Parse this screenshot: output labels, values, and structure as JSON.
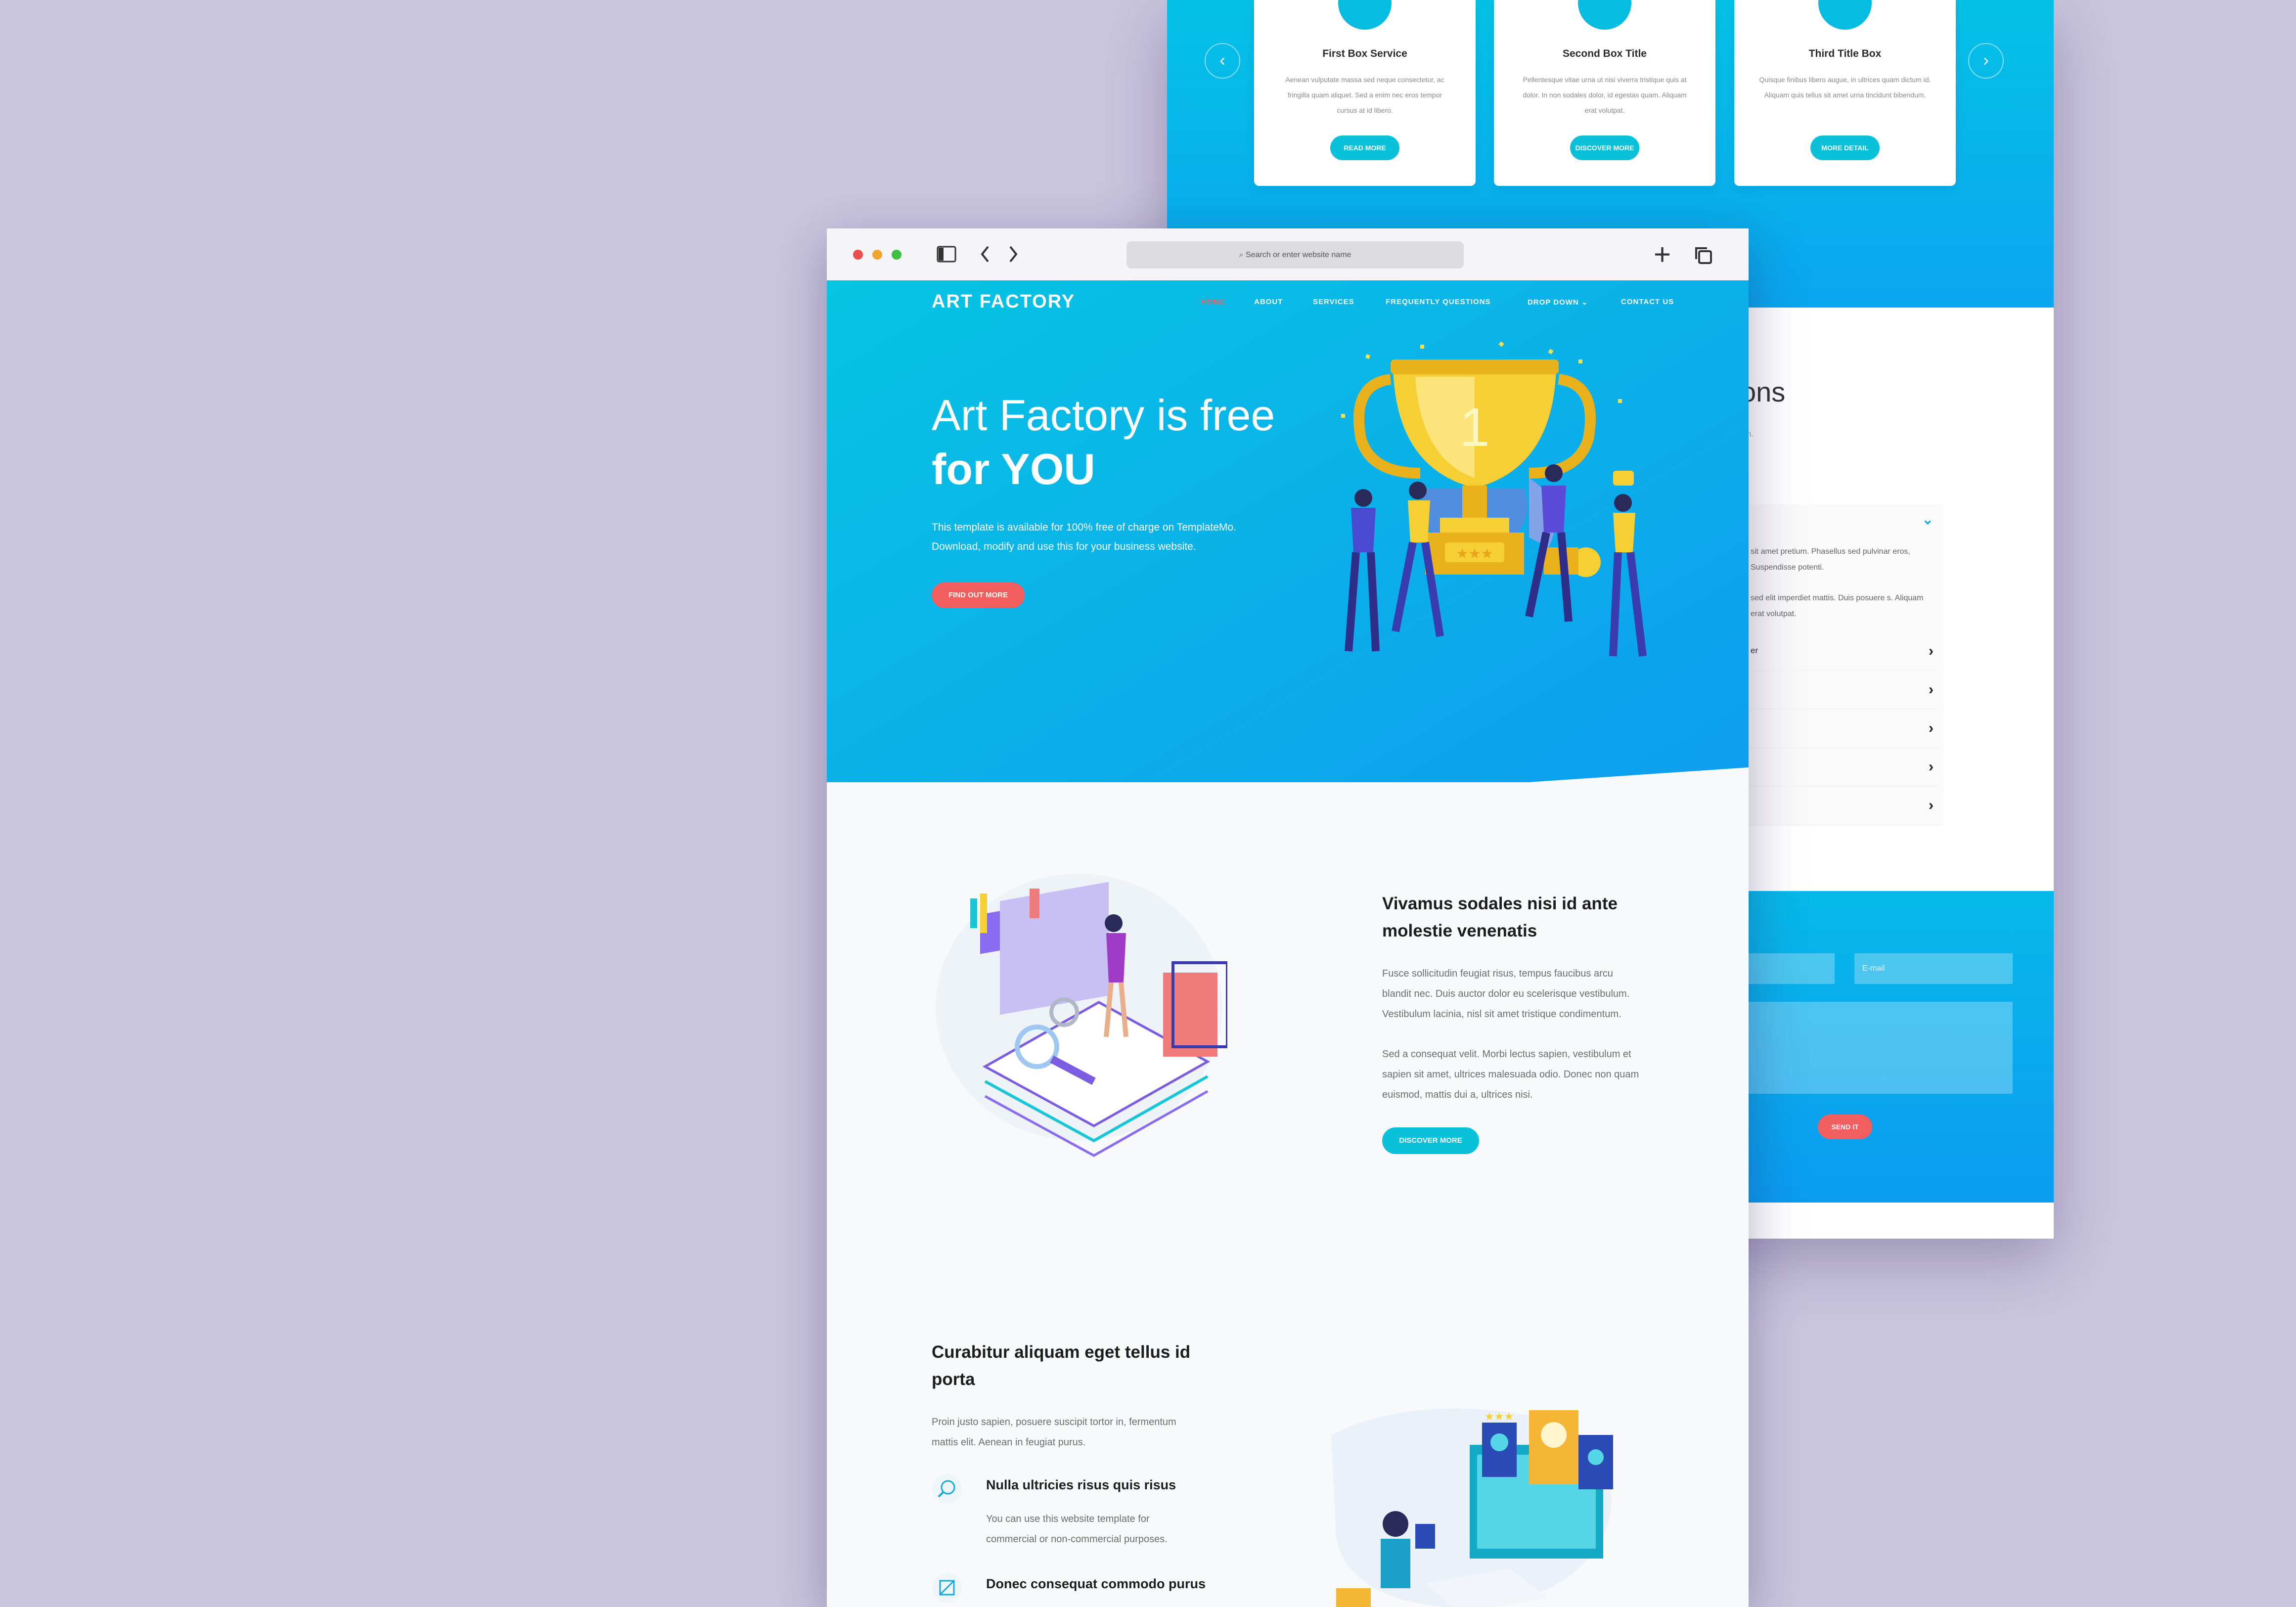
{
  "back_page": {
    "services": [
      {
        "title": "First Box Service",
        "desc": "Aenean vulputate massa sed neque consectetur, ac fringilla quam aliquet. Sed a enim nec eros tempor cursus at id libero.",
        "button": "READ MORE"
      },
      {
        "title": "Second Box Title",
        "desc": "Pellentesque vitae urna ut nisi viverra tristique quis at dolor. In non sodales dolor, id egestas quam. Aliquam erat volutpat.",
        "button": "DISCOVER MORE"
      },
      {
        "title": "Third Title Box",
        "desc": "Quisque finibus libero augue, in ultrices quam dictum id. Aliquam quis tellus sit amet urna tincidunt bibendum.",
        "button": "MORE DETAIL"
      }
    ],
    "prev_arrow": "‹",
    "next_arrow": "›",
    "faq_heading_fragment": "ons",
    "faq_sub_fragment": "ien.",
    "faq_open_text_1": "sit amet pretium. Phasellus sed pulvinar eros, Suspendisse potenti.",
    "faq_open_text_2": "sed elit imperdiet mattis. Duis posuere s. Aliquam erat volutpat.",
    "faq_row_fragment": "er",
    "email_placeholder": "E-mail",
    "send_button": "SEND IT"
  },
  "browser": {
    "address_placeholder": "Search or enter website name",
    "plus_icon": "+"
  },
  "nav": {
    "logo": "ART FACTORY",
    "items": [
      "HOME",
      "ABOUT",
      "SERVICES",
      "FREQUENTLY QUESTIONS",
      "DROP DOWN",
      "CONTACT US"
    ],
    "dropdown_caret": "⌄"
  },
  "hero": {
    "title_line1": "Art Factory is free",
    "title_line2": "for YOU",
    "text_line1": "This template is available for 100% free of charge on TemplateMo.",
    "text_line2": "Download, modify and use this for your business website.",
    "button": "FIND OUT MORE",
    "trophy_number": "1",
    "stars": "★★★"
  },
  "section2": {
    "heading_line1": "Vivamus sodales nisi id ante",
    "heading_line2": "molestie venenatis",
    "para1_lines": [
      "Fusce sollicitudin feugiat risus, tempus faucibus arcu",
      "blandit nec. Duis auctor dolor eu scelerisque vestibulum.",
      "Vestibulum lacinia, nisl sit amet tristique condimentum."
    ],
    "para2_lines": [
      "Sed a consequat velit. Morbi lectus sapien, vestibulum et",
      "sapien sit amet, ultrices malesuada odio. Donec non quam",
      "euismod, mattis dui a, ultrices nisi."
    ],
    "button": "DISCOVER MORE"
  },
  "section3": {
    "heading_line1": "Curabitur aliquam eget tellus id",
    "heading_line2": "porta",
    "text_line1": "Proin justo sapien, posuere suscipit tortor in, fermentum",
    "text_line2": "mattis elit. Aenean in feugiat purus.",
    "feature1_title": "Nulla ultricies risus quis risus",
    "feature1_line1": "You can use this website template for",
    "feature1_line2": "commercial or non-commercial purposes.",
    "feature2_title": "Donec consequat commodo purus",
    "review_stars": "★★★"
  },
  "colors": {
    "cyan": "#0bc0dd",
    "blue": "#0d9df0",
    "coral": "#f25d5d",
    "background": "#cac6df"
  }
}
